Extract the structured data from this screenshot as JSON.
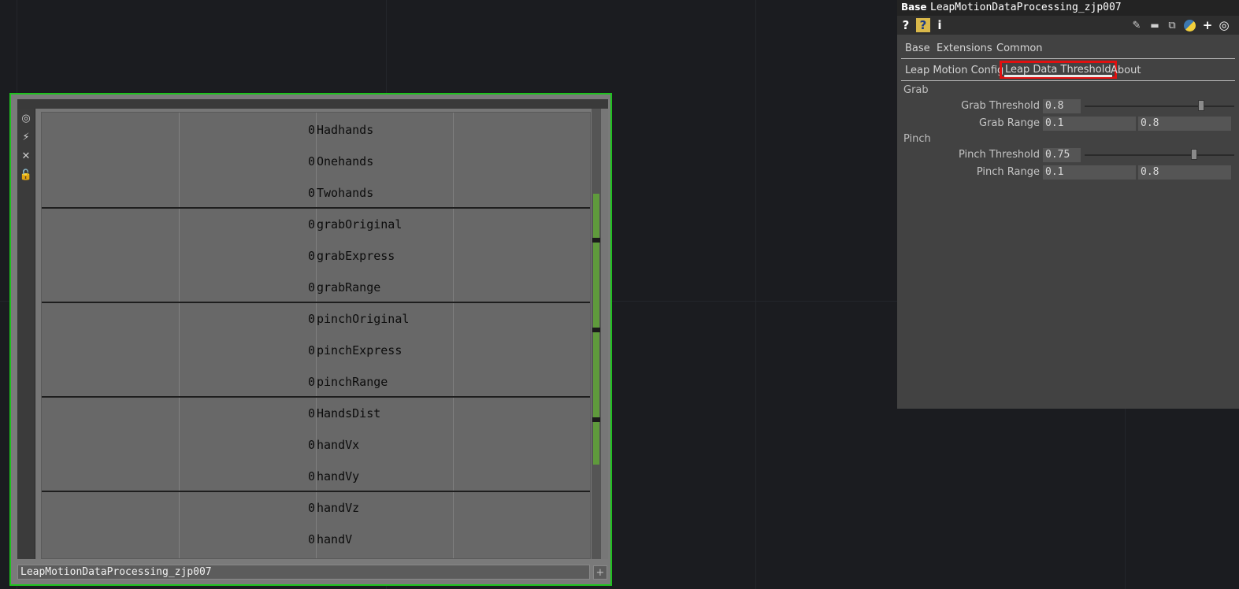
{
  "node": {
    "footer_name": "LeapMotionDataProcessing_zjp007",
    "rows": [
      {
        "value": "0",
        "name": "Hadhands"
      },
      {
        "value": "0",
        "name": "Onehands"
      },
      {
        "value": "0",
        "name": "Twohands"
      },
      {
        "value": "0",
        "name": "grabOriginal"
      },
      {
        "value": "0",
        "name": "grabExpress"
      },
      {
        "value": "0",
        "name": "grabRange"
      },
      {
        "value": "0",
        "name": "pinchOriginal"
      },
      {
        "value": "0",
        "name": "pinchExpress"
      },
      {
        "value": "0",
        "name": "pinchRange"
      },
      {
        "value": "0",
        "name": "HandsDist"
      },
      {
        "value": "0",
        "name": "handVx"
      },
      {
        "value": "0",
        "name": "handVy"
      },
      {
        "value": "0",
        "name": "handVz"
      },
      {
        "value": "0",
        "name": "handV"
      }
    ],
    "side_icons": [
      "target-icon",
      "graph-icon",
      "close-icon",
      "lock-icon"
    ],
    "plus_label": "+"
  },
  "panel": {
    "type_label": "Base",
    "op_name": "LeapMotionDataProcessing_zjp007",
    "tools_left": [
      {
        "name": "help-icon",
        "glyph": "?"
      },
      {
        "name": "op-help-icon",
        "glyph": "?"
      },
      {
        "name": "info-icon",
        "glyph": "i"
      }
    ],
    "tools_right": [
      {
        "name": "pencil-icon",
        "glyph": "✎"
      },
      {
        "name": "comment-icon",
        "glyph": "💬"
      },
      {
        "name": "clipboard-icon",
        "glyph": "⧉"
      },
      {
        "name": "python-icon",
        "glyph": "●"
      },
      {
        "name": "plus-icon",
        "glyph": "+"
      },
      {
        "name": "target-icon",
        "glyph": "◎"
      }
    ],
    "tabs_row1": [
      "Base",
      "Extensions",
      "Common"
    ],
    "tabs_row2": [
      "Leap Motion Config",
      "Leap Data Threshold",
      "About"
    ],
    "active_tab": "Leap Data Threshold",
    "sections": {
      "grab": {
        "title": "Grab",
        "threshold_label": "Grab Threshold",
        "threshold_value": "0.8",
        "threshold_fraction": 0.8,
        "range_label": "Grab Range",
        "range_min": "0.1",
        "range_max": "0.8"
      },
      "pinch": {
        "title": "Pinch",
        "threshold_label": "Pinch Threshold",
        "threshold_value": "0.75",
        "threshold_fraction": 0.75,
        "range_label": "Pinch Range",
        "range_min": "0.1",
        "range_max": "0.8"
      }
    },
    "accent_highlight": "#e01010",
    "node_border": "#1fc21f"
  }
}
